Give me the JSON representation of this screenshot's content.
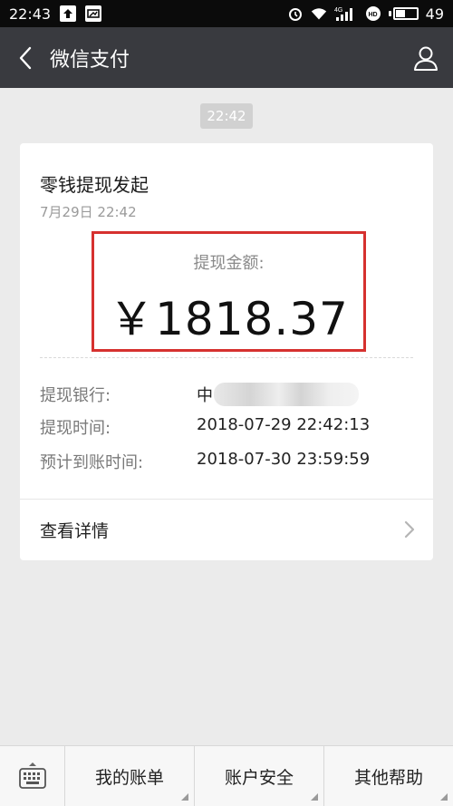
{
  "status_bar": {
    "time": "22:43",
    "network": "4G",
    "battery": "49",
    "battery_level": 0.49,
    "icons": [
      "upload-icon",
      "screenshot-icon",
      "alarm-icon",
      "wifi-icon",
      "signal-icon",
      "hd-icon",
      "battery-icon"
    ]
  },
  "title_bar": {
    "title": "微信支付",
    "back_icon": "back-arrow-icon",
    "profile_icon": "person-icon"
  },
  "timestamp": "22:42",
  "card": {
    "title": "零钱提现发起",
    "date": "7月29日  22:42",
    "amount_label": "提现金额:",
    "amount": "￥1818.37",
    "highlight_color": "#d6312f",
    "rows": [
      {
        "key": "提现银行:",
        "value": "中"
      },
      {
        "key": "提现时间:",
        "value": "2018-07-29 22:42:13"
      },
      {
        "key": "预计到账时间:",
        "value": "2018-07-30 23:59:59"
      }
    ],
    "details_label": "查看详情"
  },
  "bottom_menu": {
    "items": [
      {
        "label": "我的账单"
      },
      {
        "label": "账户安全"
      },
      {
        "label": "其他帮助"
      }
    ]
  },
  "colors": {
    "status_bar": "#0b0b0b",
    "title_bar": "#393a3f",
    "background": "#ebebeb"
  }
}
